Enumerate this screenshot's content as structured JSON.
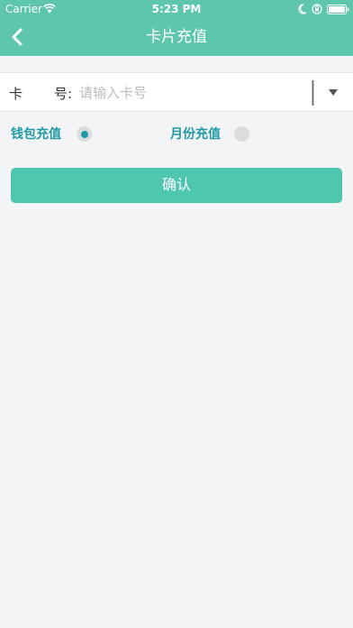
{
  "status_bar": {
    "carrier": "Carrier",
    "time": "5:23 PM"
  },
  "navbar": {
    "title": "卡片充值",
    "back_icon": "chevron-left-icon"
  },
  "card_field": {
    "label_part1": "卡",
    "label_part2": "号:",
    "placeholder": "请输入卡号",
    "value": "",
    "dropdown_icon": "triangle-down-icon"
  },
  "recharge_options": [
    {
      "label": "钱包充值",
      "selected": true
    },
    {
      "label": "月份充值",
      "selected": false
    }
  ],
  "confirm_button": {
    "label": "确认"
  },
  "colors": {
    "header": "#5fc6ae",
    "accent": "#1f9aa5",
    "button": "#4ec6b0",
    "background": "#f3f4f6"
  }
}
